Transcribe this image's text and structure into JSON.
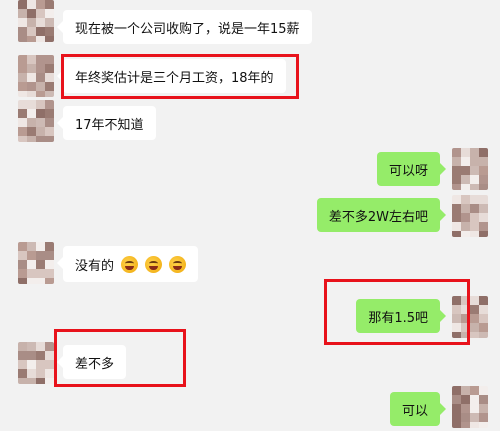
{
  "messages": [
    {
      "side": "left",
      "text": "现在被一个公司收购了，说是一年15薪"
    },
    {
      "side": "left",
      "text": "年终奖估计是三个月工资，18年的"
    },
    {
      "side": "left",
      "text": "17年不知道"
    },
    {
      "side": "right",
      "text": "可以呀"
    },
    {
      "side": "right",
      "text": "差不多2W左右吧"
    },
    {
      "side": "left",
      "text": "没有的",
      "emoji": "laughing-crying-emoji"
    },
    {
      "side": "right",
      "text": "那有1.5吧"
    },
    {
      "side": "left",
      "text": "差不多"
    },
    {
      "side": "right",
      "text": "可以"
    }
  ],
  "colors": {
    "background": "#f2f2f2",
    "left_bubble": "#ffffff",
    "right_bubble": "#95ec69",
    "highlight": "#e8121b"
  },
  "icons": {
    "avatar": "pixelated-avatar-icon",
    "emoji": "laughing-crying-emoji-icon"
  }
}
